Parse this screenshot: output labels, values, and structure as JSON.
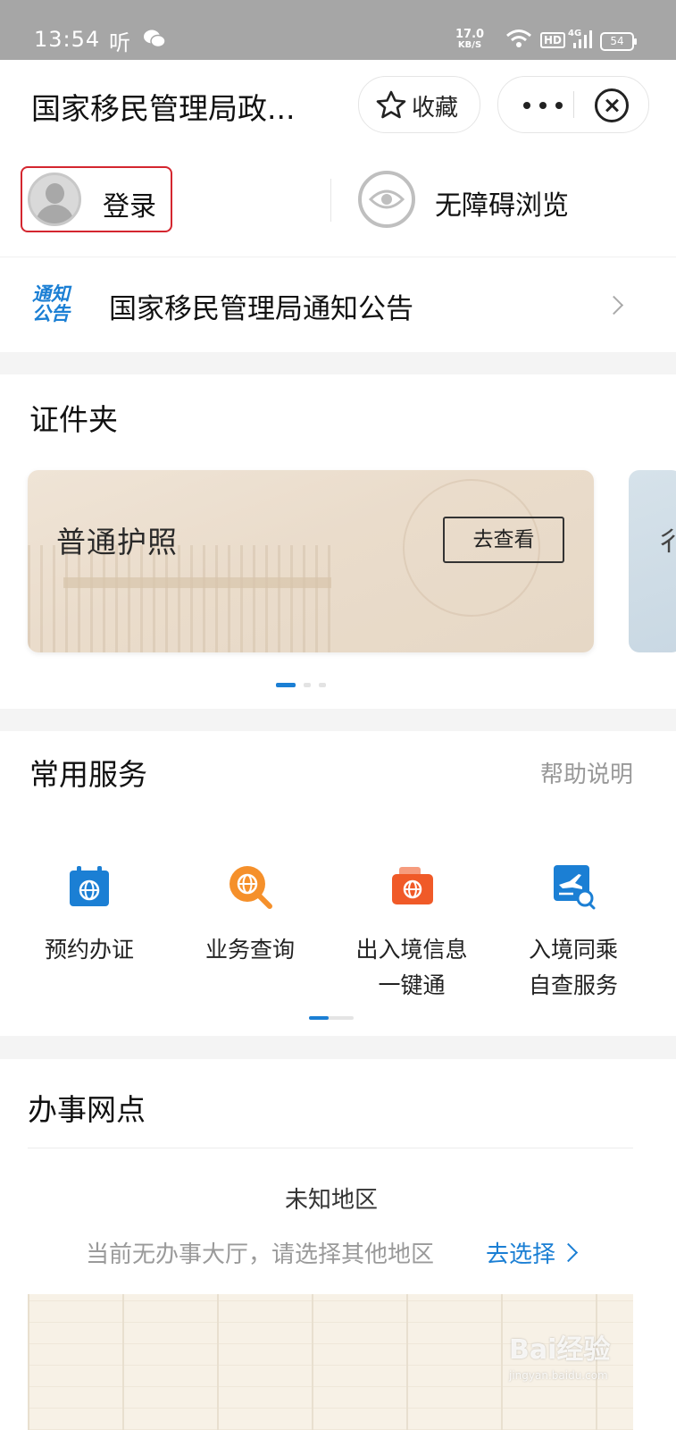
{
  "status_bar": {
    "time": "13:54",
    "listen_label": "听",
    "net_speed": "17.0",
    "net_unit": "KB/S",
    "hd_label": "HD",
    "signal_label": "4G",
    "battery": "54"
  },
  "nav": {
    "title": "国家移民管理局政...",
    "favorite_label": "收藏"
  },
  "account": {
    "login_label": "登录",
    "accessibility_label": "无障碍浏览"
  },
  "notice": {
    "icon_line1": "通知",
    "icon_line2": "公告",
    "text": "国家移民管理局通知公告"
  },
  "wallet": {
    "title": "证件夹",
    "card_name": "普通护照",
    "card_button": "去查看",
    "next_card_peek": "彳"
  },
  "services": {
    "title": "常用服务",
    "help_label": "帮助说明",
    "items": [
      {
        "label_line1": "预约办证",
        "label_line2": "",
        "icon": "calendar-globe-icon",
        "color": "#1b7fd4"
      },
      {
        "label_line1": "业务查询",
        "label_line2": "",
        "icon": "search-globe-icon",
        "color": "#f5902b"
      },
      {
        "label_line1": "出入境信息",
        "label_line2": "一键通",
        "icon": "wallet-globe-icon",
        "color": "#f05a28"
      },
      {
        "label_line1": "入境同乘",
        "label_line2": "自查服务",
        "icon": "flight-search-icon",
        "color": "#1b7fd4"
      }
    ]
  },
  "offices": {
    "title": "办事网点",
    "region": "未知地区",
    "no_hall_text": "当前无办事大厅，请选择其他地区",
    "choose_label": "去选择"
  },
  "watermark": {
    "brand": "Bai经验",
    "url": "jingyan.baidu.com"
  },
  "colors": {
    "accent_blue": "#1b7fd4",
    "highlight_red": "#d4262f"
  }
}
